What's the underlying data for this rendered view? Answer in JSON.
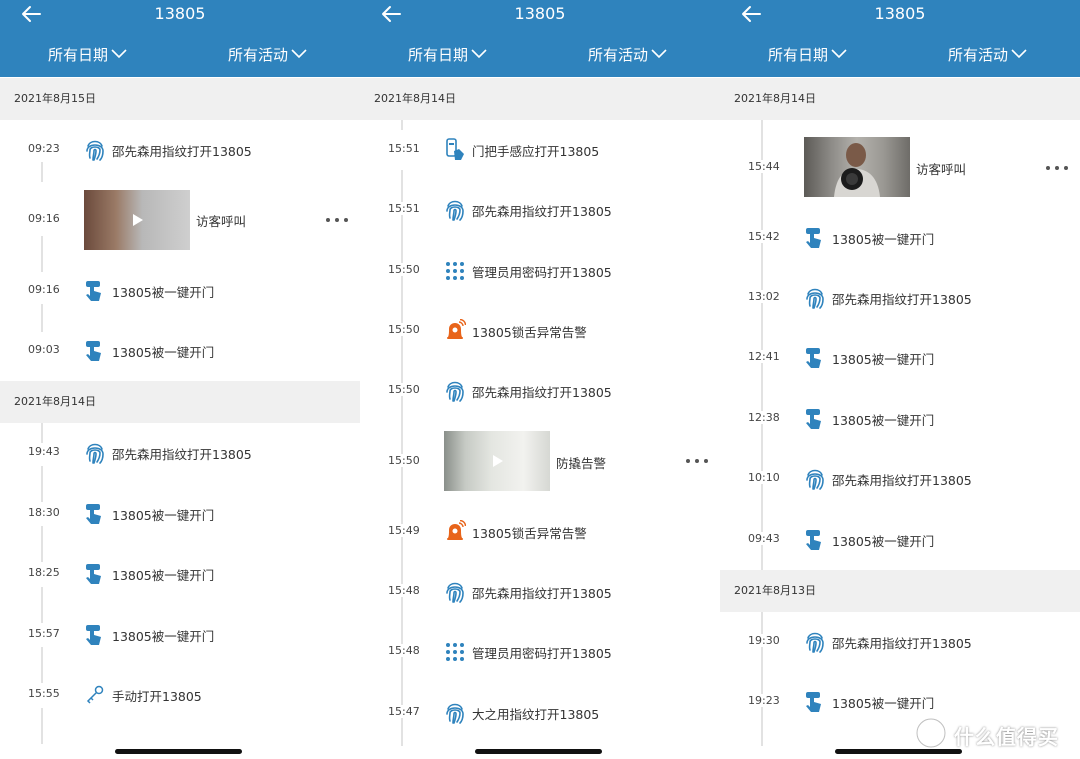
{
  "header": {
    "title": "13805",
    "filter_date": "所有日期",
    "filter_activity": "所有活动"
  },
  "colors": {
    "header": "#2f83bd",
    "icon_blue": "#2f83bd",
    "alert_orange": "#e8641a",
    "date_bg": "#f0f0f0"
  },
  "panel1": {
    "date1": "2021年8月15日",
    "date2": "2021年8月14日",
    "entries": [
      {
        "time": "09:23",
        "icon": "fingerprint-icon",
        "label": "邵先森用指纹打开13805"
      },
      {
        "time": "09:16",
        "icon": "video-thumbnail",
        "label": "访客呼叫"
      },
      {
        "time": "09:16",
        "icon": "one-key-open-icon",
        "label": "13805被一键开门"
      },
      {
        "time": "09:03",
        "icon": "one-key-open-icon",
        "label": "13805被一键开门"
      },
      {
        "time": "19:43",
        "icon": "fingerprint-icon",
        "label": "邵先森用指纹打开13805"
      },
      {
        "time": "18:30",
        "icon": "one-key-open-icon",
        "label": "13805被一键开门"
      },
      {
        "time": "18:25",
        "icon": "one-key-open-icon",
        "label": "13805被一键开门"
      },
      {
        "time": "15:57",
        "icon": "one-key-open-icon",
        "label": "13805被一键开门"
      },
      {
        "time": "15:55",
        "icon": "key-icon",
        "label": "手动打开13805"
      }
    ]
  },
  "panel2": {
    "date1": "2021年8月14日",
    "entries": [
      {
        "time": "15:51",
        "icon": "door-handle-sensor-icon",
        "label": "门把手感应打开13805"
      },
      {
        "time": "15:51",
        "icon": "fingerprint-icon",
        "label": "邵先森用指纹打开13805"
      },
      {
        "time": "15:50",
        "icon": "keypad-icon",
        "label": "管理员用密码打开13805"
      },
      {
        "time": "15:50",
        "icon": "alarm-bell-icon",
        "label": "13805锁舌异常告警"
      },
      {
        "time": "15:50",
        "icon": "fingerprint-icon",
        "label": "邵先森用指纹打开13805"
      },
      {
        "time": "15:50",
        "icon": "video-thumbnail",
        "label": "防撬告警"
      },
      {
        "time": "15:49",
        "icon": "alarm-bell-icon",
        "label": "13805锁舌异常告警"
      },
      {
        "time": "15:48",
        "icon": "fingerprint-icon",
        "label": "邵先森用指纹打开13805"
      },
      {
        "time": "15:48",
        "icon": "keypad-icon",
        "label": "管理员用密码打开13805"
      },
      {
        "time": "15:47",
        "icon": "fingerprint-icon",
        "label": "大之用指纹打开13805"
      }
    ]
  },
  "panel3": {
    "date1": "2021年8月14日",
    "date2": "2021年8月13日",
    "entries": [
      {
        "time": "15:44",
        "icon": "video-thumbnail",
        "label": "访客呼叫"
      },
      {
        "time": "15:42",
        "icon": "one-key-open-icon",
        "label": "13805被一键开门"
      },
      {
        "time": "13:02",
        "icon": "fingerprint-icon",
        "label": "邵先森用指纹打开13805"
      },
      {
        "time": "12:41",
        "icon": "one-key-open-icon",
        "label": "13805被一键开门"
      },
      {
        "time": "12:38",
        "icon": "one-key-open-icon",
        "label": "13805被一键开门"
      },
      {
        "time": "10:10",
        "icon": "fingerprint-icon",
        "label": "邵先森用指纹打开13805"
      },
      {
        "time": "09:43",
        "icon": "one-key-open-icon",
        "label": "13805被一键开门"
      },
      {
        "time": "19:30",
        "icon": "fingerprint-icon",
        "label": "邵先森用指纹打开13805"
      },
      {
        "time": "19:23",
        "icon": "one-key-open-icon",
        "label": "13805被一键开门"
      }
    ]
  },
  "watermark": {
    "text": "什么值得买"
  }
}
